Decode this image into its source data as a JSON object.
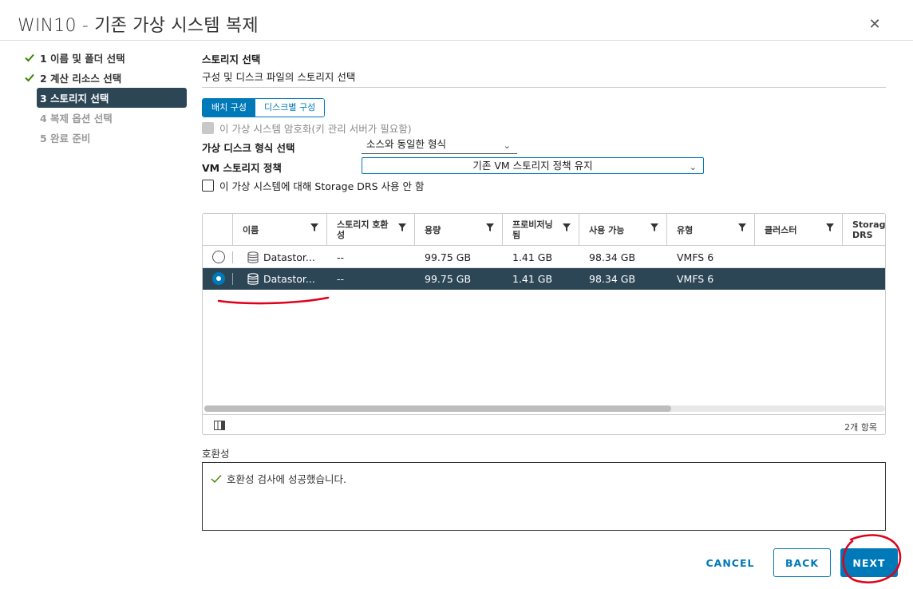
{
  "dialog": {
    "title": "WIN10 - 기존 가상 시스템 복제"
  },
  "steps": [
    {
      "label": "1 이름 및 폴더 선택",
      "state": "done"
    },
    {
      "label": "2 계산 리소스 선택",
      "state": "done"
    },
    {
      "label": "3 스토리지 선택",
      "state": "active"
    },
    {
      "label": "4 복제 옵션 선택",
      "state": "disabled"
    },
    {
      "label": "5 완료 준비",
      "state": "disabled"
    }
  ],
  "main": {
    "title": "스토리지 선택",
    "subtitle": "구성 및 디스크 파일의 스토리지 선택",
    "tabs": [
      {
        "label": "배치 구성",
        "active": true
      },
      {
        "label": "디스크별 구성",
        "active": false
      }
    ],
    "encrypt_label": "이 가상 시스템 암호화(키 관리 서버가 필요함)",
    "disk_format_label": "가상 디스크 형식 선택",
    "disk_format_value": "소스와 동일한 형식",
    "vm_policy_label": "VM 스토리지 정책",
    "vm_policy_value": "기존 VM 스토리지 정책 유지",
    "drs_label": "이 가상 시스템에 대해 Storage DRS 사용 안 함"
  },
  "grid": {
    "columns": [
      "이름",
      "스토리지 호환성",
      "용량",
      "프로비저닝됨",
      "사용 가능",
      "유형",
      "클러스터",
      "Storage DRS"
    ],
    "col_name": "이름",
    "col_compat_1": "스토리지 호환",
    "col_compat_2": "성",
    "col_capacity": "용량",
    "col_prov_1": "프로비저닝",
    "col_prov_2": "됨",
    "col_free": "사용 가능",
    "col_type": "유형",
    "col_cluster": "클러스터",
    "col_drs_1": "Storage",
    "col_drs_2": "DRS",
    "rows": [
      {
        "name": "Datastor...",
        "compat": "--",
        "capacity": "99.75 GB",
        "provisioned": "1.41 GB",
        "free": "98.34 GB",
        "type": "VMFS 6",
        "selected": false
      },
      {
        "name": "Datastor...",
        "compat": "--",
        "capacity": "99.75 GB",
        "provisioned": "1.41 GB",
        "free": "98.34 GB",
        "type": "VMFS 6",
        "selected": true
      }
    ],
    "item_count": "2개 항목"
  },
  "compat": {
    "label": "호환성",
    "message": "호환성 검사에 성공했습니다."
  },
  "buttons": {
    "cancel": "CANCEL",
    "back": "BACK",
    "next": "NEXT"
  },
  "colors": {
    "accent": "#0079b8",
    "selected_row": "#2d4656",
    "check_green": "#3c8500",
    "annotation_red": "#e0001a"
  }
}
